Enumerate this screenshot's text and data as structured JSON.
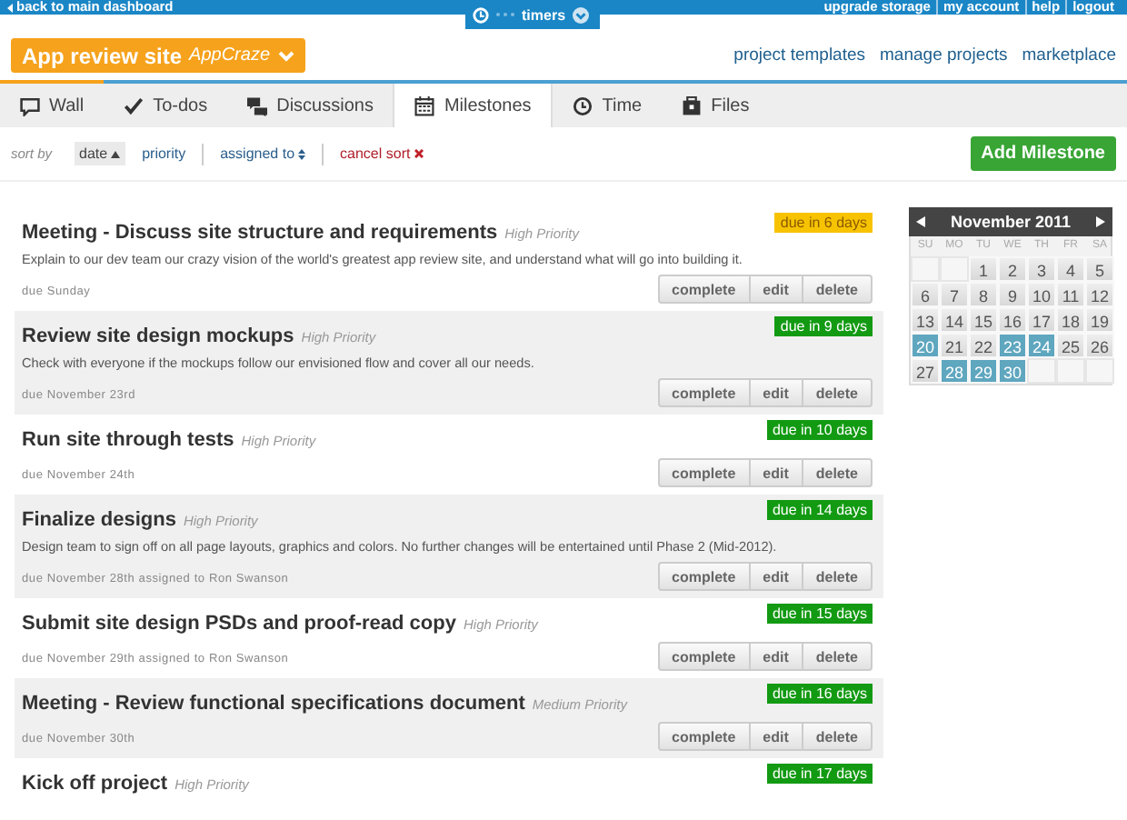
{
  "top_bar": {
    "back_link": "back to main dashboard",
    "timers": "timers",
    "links": [
      "upgrade storage",
      "my account",
      "help",
      "logout"
    ]
  },
  "project": {
    "name": "App review site",
    "client": "AppCraze"
  },
  "header_links": [
    "project templates",
    "manage projects",
    "marketplace"
  ],
  "tabs": [
    {
      "label": "Wall",
      "selected": false
    },
    {
      "label": "To-dos",
      "selected": false
    },
    {
      "label": "Discussions",
      "selected": false
    },
    {
      "label": "Milestones",
      "selected": true
    },
    {
      "label": "Time",
      "selected": false
    },
    {
      "label": "Files",
      "selected": false
    }
  ],
  "sort": {
    "label": "sort by",
    "options": [
      {
        "label": "date",
        "selected": true,
        "kind": "asc"
      },
      {
        "label": "priority",
        "selected": false,
        "kind": "plain"
      },
      {
        "label": "assigned to",
        "selected": false,
        "kind": "both"
      },
      {
        "label": "cancel sort",
        "selected": false,
        "kind": "cancel"
      }
    ]
  },
  "add_button": "Add Milestone",
  "milestones": [
    {
      "title": "Meeting - Discuss site structure and requirements",
      "priority": "High Priority",
      "description": "Explain to our dev team our crazy vision of the world's greatest app review site, and understand what will go into building it.",
      "due": "due Sunday",
      "badge": "due in 6 days",
      "urgent": true,
      "buttons": [
        "complete",
        "edit",
        "delete"
      ]
    },
    {
      "title": "Review site design mockups",
      "priority": "High Priority",
      "description": "Check with everyone if the mockups follow our envisioned flow and cover all our needs.",
      "due": "due November 23rd",
      "badge": "due in 9 days",
      "urgent": false,
      "buttons": [
        "complete",
        "edit",
        "delete"
      ]
    },
    {
      "title": "Run site through tests",
      "priority": "High Priority",
      "due": "due November 24th",
      "badge": "due in 10 days",
      "urgent": false,
      "buttons": [
        "complete",
        "edit",
        "delete"
      ]
    },
    {
      "title": "Finalize designs",
      "priority": "High Priority",
      "description": "Design team to sign off on all page layouts, graphics and colors. No further changes will be entertained until Phase 2 (Mid-2012).",
      "due": "due November 28th assigned to Ron Swanson",
      "badge": "due in 14 days",
      "urgent": false,
      "buttons": [
        "complete",
        "edit",
        "delete"
      ]
    },
    {
      "title": "Submit site design PSDs and proof-read copy",
      "priority": "High Priority",
      "due": "due November 29th assigned to Ron Swanson",
      "badge": "due in 15 days",
      "urgent": false,
      "buttons": [
        "complete",
        "edit",
        "delete"
      ]
    },
    {
      "title": "Meeting - Review functional specifications document",
      "priority": "Medium Priority",
      "due": "due November 30th",
      "badge": "due in 16 days",
      "urgent": false,
      "buttons": [
        "complete",
        "edit",
        "delete"
      ]
    },
    {
      "title": "Kick off project",
      "priority": "High Priority",
      "badge": "due in 17 days",
      "urgent": false
    }
  ],
  "calendar": {
    "title": "November 2011",
    "weekdays": [
      "SU",
      "MO",
      "TU",
      "WE",
      "TH",
      "FR",
      "SA"
    ],
    "weeks": [
      [
        {
          "kind": "blank"
        },
        {
          "kind": "blank"
        },
        {
          "kind": "day",
          "day": "1",
          "marked": false
        },
        {
          "kind": "day",
          "day": "2",
          "marked": false
        },
        {
          "kind": "day",
          "day": "3",
          "marked": false
        },
        {
          "kind": "day",
          "day": "4",
          "marked": false
        },
        {
          "kind": "day",
          "day": "5",
          "marked": false
        }
      ],
      [
        {
          "kind": "day",
          "day": "6",
          "marked": false
        },
        {
          "kind": "day",
          "day": "7",
          "marked": false
        },
        {
          "kind": "day",
          "day": "8",
          "marked": false
        },
        {
          "kind": "day",
          "day": "9",
          "marked": false
        },
        {
          "kind": "day",
          "day": "10",
          "marked": false
        },
        {
          "kind": "day",
          "day": "11",
          "marked": false
        },
        {
          "kind": "day",
          "day": "12",
          "marked": false
        }
      ],
      [
        {
          "kind": "day",
          "day": "13",
          "marked": false
        },
        {
          "kind": "day",
          "day": "14",
          "marked": false
        },
        {
          "kind": "day",
          "day": "15",
          "marked": false
        },
        {
          "kind": "day",
          "day": "16",
          "marked": false
        },
        {
          "kind": "day",
          "day": "17",
          "marked": false
        },
        {
          "kind": "day",
          "day": "18",
          "marked": false
        },
        {
          "kind": "day",
          "day": "19",
          "marked": false
        }
      ],
      [
        {
          "kind": "day",
          "day": "20",
          "marked": true
        },
        {
          "kind": "day",
          "day": "21",
          "marked": false
        },
        {
          "kind": "day",
          "day": "22",
          "marked": false
        },
        {
          "kind": "day",
          "day": "23",
          "marked": true
        },
        {
          "kind": "day",
          "day": "24",
          "marked": true
        },
        {
          "kind": "day",
          "day": "25",
          "marked": false
        },
        {
          "kind": "day",
          "day": "26",
          "marked": false
        }
      ],
      [
        {
          "kind": "day",
          "day": "27",
          "marked": false
        },
        {
          "kind": "day",
          "day": "28",
          "marked": true
        },
        {
          "kind": "day",
          "day": "29",
          "marked": true
        },
        {
          "kind": "day",
          "day": "30",
          "marked": true
        },
        {
          "kind": "blank"
        },
        {
          "kind": "blank"
        },
        {
          "kind": "blank"
        }
      ]
    ]
  }
}
